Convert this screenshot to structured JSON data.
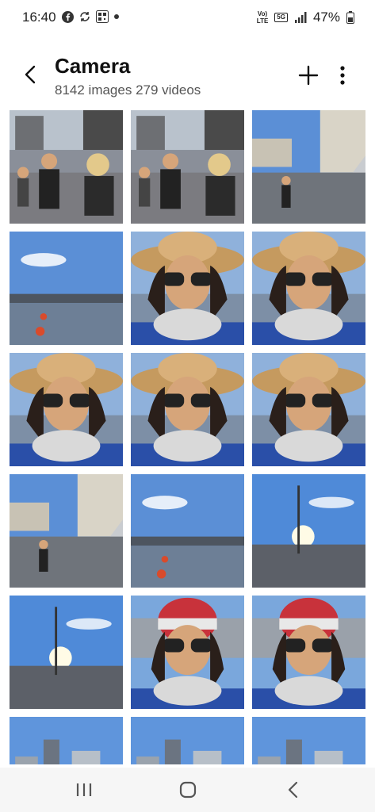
{
  "status_bar": {
    "time": "16:40",
    "network_type": "5G",
    "network_label": "Vo)) LTE",
    "battery": "47%",
    "icons_left": [
      "facebook-icon",
      "sync-icon",
      "qr-code-icon",
      "dot-icon"
    ],
    "icons_right": [
      "volte-icon",
      "5g-icon",
      "signal-icon",
      "battery-icon"
    ]
  },
  "header": {
    "title": "Camera",
    "subtitle": "8142 images 279 videos",
    "back_icon": "chevron-left-icon",
    "add_icon": "plus-icon",
    "more_icon": "more-vertical-icon"
  },
  "grid": {
    "columns": 3,
    "thumbnails": [
      {
        "kind": "street",
        "desc": "crowd-street"
      },
      {
        "kind": "street",
        "desc": "crowd-street"
      },
      {
        "kind": "bridge",
        "desc": "bridge-walkway"
      },
      {
        "kind": "river",
        "desc": "river-view"
      },
      {
        "kind": "selfie",
        "desc": "selfie-hat"
      },
      {
        "kind": "selfie",
        "desc": "selfie-hat"
      },
      {
        "kind": "selfie",
        "desc": "selfie-hat"
      },
      {
        "kind": "selfie",
        "desc": "selfie-hat"
      },
      {
        "kind": "selfie",
        "desc": "selfie-hat"
      },
      {
        "kind": "bridge",
        "desc": "bridge-walkway"
      },
      {
        "kind": "river",
        "desc": "river-view"
      },
      {
        "kind": "sunset",
        "desc": "sun-street"
      },
      {
        "kind": "sunset",
        "desc": "sun-street"
      },
      {
        "kind": "beanie",
        "desc": "selfie-beanie"
      },
      {
        "kind": "beanie",
        "desc": "selfie-beanie"
      },
      {
        "kind": "city",
        "desc": "city-skyline"
      },
      {
        "kind": "city",
        "desc": "city-skyline"
      },
      {
        "kind": "city",
        "desc": "city-skyline"
      }
    ]
  },
  "navbar": {
    "items": [
      "recent-apps-icon",
      "home-icon",
      "back-icon"
    ]
  },
  "colors": {
    "sky": "#5b8fd6",
    "water": "#6d7f96",
    "hat": "#c59a5f",
    "jacket": "#2a4fa8",
    "fur": "#d9d9d9",
    "skin": "#d6a57a"
  }
}
